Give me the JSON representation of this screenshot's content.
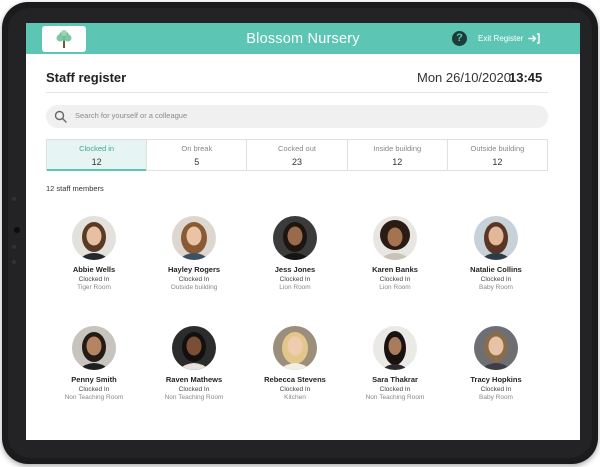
{
  "app": {
    "title": "Blossom Nursery",
    "help_symbol": "?",
    "exit_label": "Exit Register",
    "accent_color": "#5cc5b4"
  },
  "header": {
    "title": "Staff register",
    "date": "Mon 26/10/2020",
    "time": "13:45"
  },
  "search": {
    "placeholder": "Search for yourself or a colleague"
  },
  "tabs": [
    {
      "label": "Clocked in",
      "count": "12",
      "active": true
    },
    {
      "label": "On break",
      "count": "5",
      "active": false
    },
    {
      "label": "Cocked out",
      "count": "23",
      "active": false
    },
    {
      "label": "Inside building",
      "count": "12",
      "active": false
    },
    {
      "label": "Outside building",
      "count": "12",
      "active": false
    }
  ],
  "staff_count_label": "12 staff members",
  "staff": [
    {
      "name": "Abbie Wells",
      "status": "Clocked In",
      "room": "Tiger Room"
    },
    {
      "name": "Hayley Rogers",
      "status": "Clocked In",
      "room": "Outside building"
    },
    {
      "name": "Jess Jones",
      "status": "Clocked In",
      "room": "Lion Room"
    },
    {
      "name": "Karen Banks",
      "status": "Clocked In",
      "room": "Lion Room"
    },
    {
      "name": "Natalie Collins",
      "status": "Clocked In",
      "room": "Baby Room"
    },
    {
      "name": "Penny Smith",
      "status": "Clocked In",
      "room": "Non Teaching Room"
    },
    {
      "name": "Raven Mathews",
      "status": "Clocked In",
      "room": "Non Teaching Room"
    },
    {
      "name": "Rebecca Stevens",
      "status": "Clocked In",
      "room": "Kitchen"
    },
    {
      "name": "Sara Thakrar",
      "status": "Clocked In",
      "room": "Non Teaching Room"
    },
    {
      "name": "Tracy Hopkins",
      "status": "Clocked In",
      "room": "Baby Room"
    }
  ],
  "icons": {
    "logo": "tree-icon",
    "help": "help-icon",
    "exit": "exit-icon",
    "search": "search-icon"
  }
}
